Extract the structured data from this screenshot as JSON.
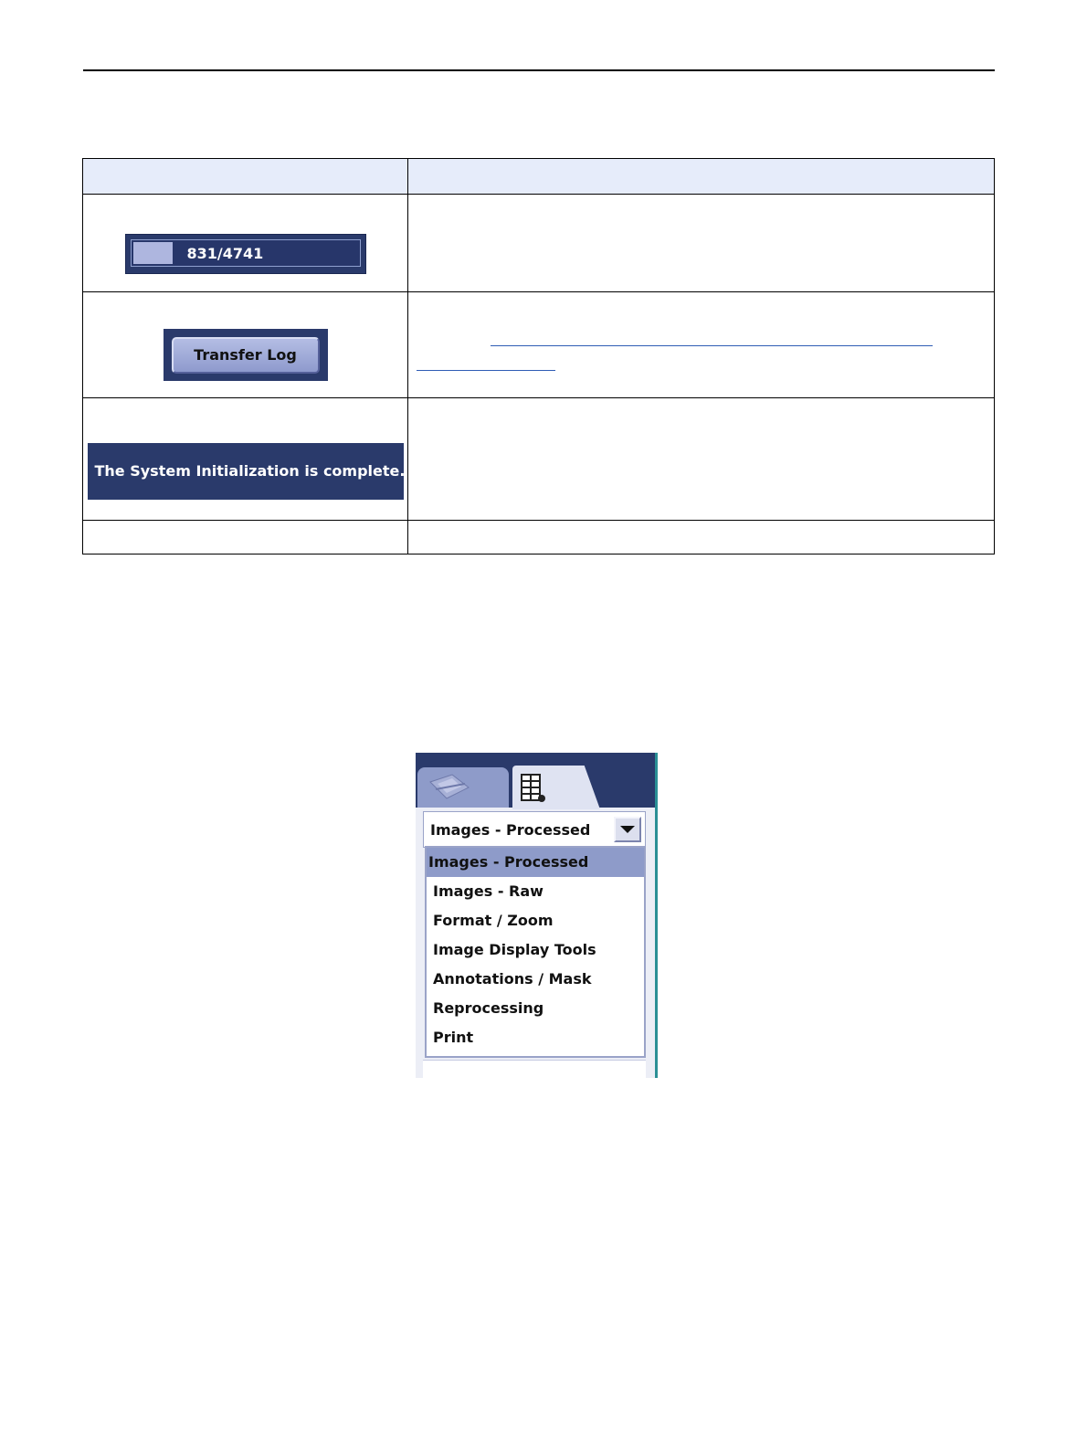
{
  "table": {
    "row1": {
      "progress_text": "831/4741",
      "progress_fraction": 0.175
    },
    "row2": {
      "button_label": "Transfer Log"
    },
    "row3": {
      "status_message": "The System Initialization is complete."
    }
  },
  "panel": {
    "tabs": [
      {
        "icon": "tools-tab-icon"
      },
      {
        "icon": "layout-grid-icon"
      }
    ],
    "selected_value": "Images - Processed",
    "options": [
      "Images - Processed",
      "Images - Raw",
      "Format / Zoom",
      "Image Display Tools",
      "Annotations / Mask",
      "Reprocessing",
      "Print"
    ]
  }
}
